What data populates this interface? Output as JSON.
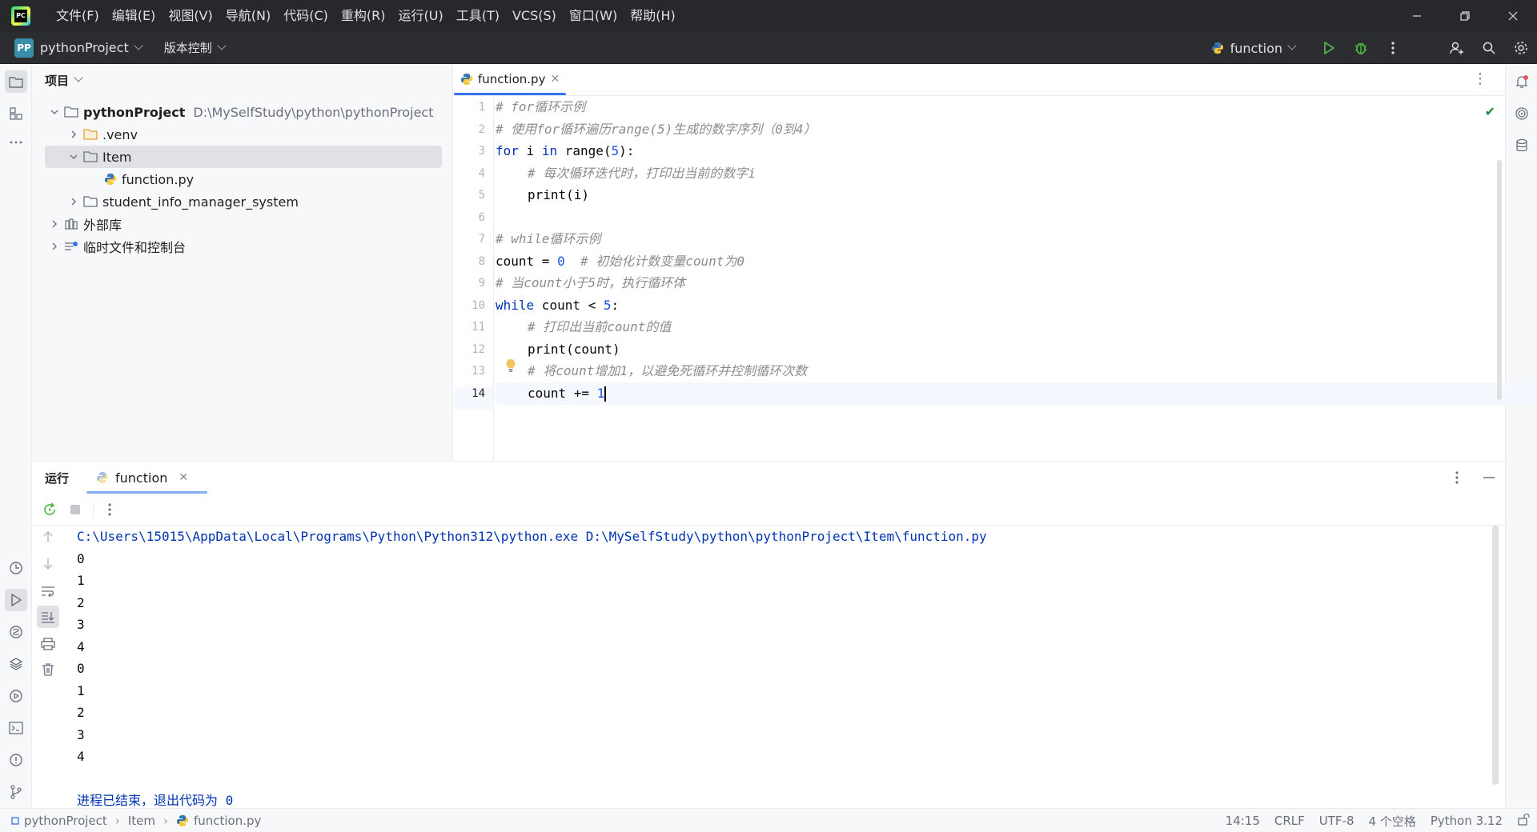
{
  "menu": [
    "文件(F)",
    "编辑(E)",
    "视图(V)",
    "导航(N)",
    "代码(C)",
    "重构(R)",
    "运行(U)",
    "工具(T)",
    "VCS(S)",
    "窗口(W)",
    "帮助(H)"
  ],
  "toolbar": {
    "project_badge": "PP",
    "project_name": "pythonProject",
    "vcs_label": "版本控制",
    "run_config": "function"
  },
  "project_panel": {
    "title": "项目",
    "root_name": "pythonProject",
    "root_path": "D:\\MySelfStudy\\python\\pythonProject",
    "items": [
      {
        "label": ".venv"
      },
      {
        "label": "Item"
      },
      {
        "label": "function.py"
      },
      {
        "label": "student_info_manager_system"
      },
      {
        "label": "外部库"
      },
      {
        "label": "临时文件和控制台"
      }
    ]
  },
  "editor": {
    "tab_label": "function.py",
    "line_numbers": [
      "1",
      "2",
      "3",
      "4",
      "5",
      "6",
      "7",
      "8",
      "9",
      "10",
      "11",
      "12",
      "13",
      "14"
    ],
    "lines": {
      "l1": "# for循环示例",
      "l2": "# 使用for循环遍历range(5)生成的数字序列（0到4）",
      "l3_kw": "for",
      "l3_a": " i ",
      "l3_in": "in",
      "l3_range": " range(",
      "l3_num": "5",
      "l3_end": "):",
      "l4": "# 每次循环迭代时，打印出当前的数字i",
      "l5": "print(i)",
      "l7": "# while循环示例",
      "l8_code": "count = ",
      "l8_num": "0",
      "l8_cmt": "# 初始化计数变量count为0",
      "l9": "# 当count小于5时，执行循环体",
      "l10_kw": "while",
      "l10_code": " count < ",
      "l10_num": "5",
      "l10_end": ":",
      "l11": "# 打印出当前count的值",
      "l12": "print(count)",
      "l13": "# 将count增加1，以避免死循环并控制循环次数",
      "l14_code": "count += ",
      "l14_num": "1"
    }
  },
  "run_panel": {
    "title": "运行",
    "tab_label": "function",
    "command": "C:\\Users\\15015\\AppData\\Local\\Programs\\Python\\Python312\\python.exe D:\\MySelfStudy\\python\\pythonProject\\Item\\function.py",
    "output": [
      "0",
      "1",
      "2",
      "3",
      "4",
      "0",
      "1",
      "2",
      "3",
      "4"
    ],
    "exit_message": "进程已结束，退出代码为 0"
  },
  "statusbar": {
    "crumbs": [
      "pythonProject",
      "Item",
      "function.py"
    ],
    "position": "14:15",
    "line_ending": "CRLF",
    "encoding": "UTF-8",
    "indent": "4 个空格",
    "interpreter": "Python 3.12"
  },
  "colors": {
    "accent": "#3574f0",
    "run_green": "#208a3c",
    "keyword": "#0033b3",
    "number": "#1750eb",
    "comment": "#8c8c8c"
  }
}
